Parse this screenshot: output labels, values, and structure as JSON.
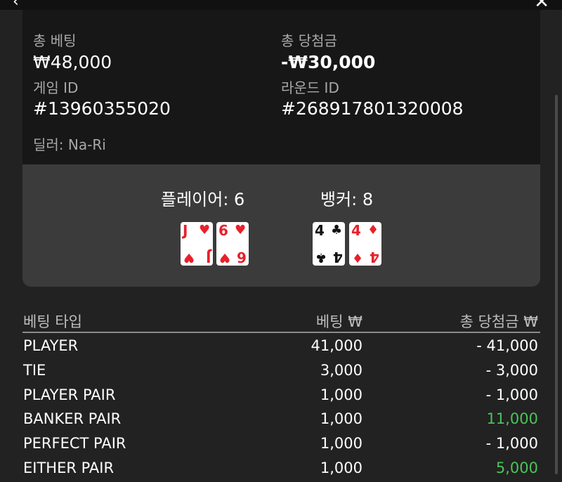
{
  "summary": {
    "total_bet_label": "총 베팅",
    "total_bet_value": "₩48,000",
    "total_win_label": "총 당첨금",
    "total_win_value": "-₩30,000",
    "game_id_label": "게임 ID",
    "game_id_value": "#13960355020",
    "round_id_label": "라운드 ID",
    "round_id_value": "#268917801320008",
    "dealer": "딜러: Na-Ri"
  },
  "hands": {
    "player_label": "플레이어: 6",
    "banker_label": "뱅커: 8",
    "player_cards": [
      {
        "rank": "J",
        "suit": "♥",
        "color": "#e8202a"
      },
      {
        "rank": "6",
        "suit": "♥",
        "color": "#e8202a"
      }
    ],
    "banker_cards": [
      {
        "rank": "4",
        "suit": "♣",
        "color": "#111111"
      },
      {
        "rank": "4",
        "suit": "♦",
        "color": "#e8202a"
      }
    ]
  },
  "bets_table": {
    "headers": [
      "베팅 타입",
      "베팅 ₩",
      "총 당첨금 ₩"
    ],
    "rows": [
      {
        "type": "PLAYER",
        "bet": "41,000",
        "win": "- 41,000",
        "win_positive": false
      },
      {
        "type": "TIE",
        "bet": "3,000",
        "win": "- 3,000",
        "win_positive": false
      },
      {
        "type": "PLAYER PAIR",
        "bet": "1,000",
        "win": "- 1,000",
        "win_positive": false
      },
      {
        "type": "BANKER PAIR",
        "bet": "1,000",
        "win": "11,000",
        "win_positive": true
      },
      {
        "type": "PERFECT PAIR",
        "bet": "1,000",
        "win": "- 1,000",
        "win_positive": false
      },
      {
        "type": "EITHER PAIR",
        "bet": "1,000",
        "win": "5,000",
        "win_positive": true
      }
    ]
  },
  "colors": {
    "background": "#222222",
    "info_panel": "#171717",
    "cards_panel": "#3b3b3b",
    "positive": "#4cc35a",
    "card_red": "#e8202a"
  }
}
